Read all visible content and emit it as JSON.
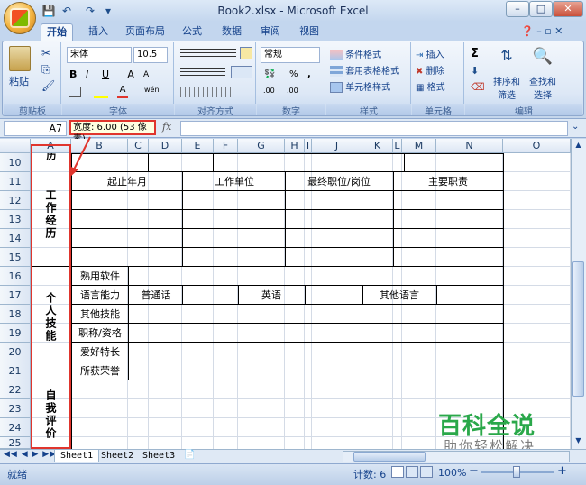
{
  "window": {
    "title": "Book2.xlsx - Microsoft Excel",
    "min": "–",
    "max": "□",
    "close": "✕"
  },
  "qat": {
    "save": "💾",
    "undo": "↶",
    "redo": "↷",
    "more": "▾"
  },
  "tabs": [
    "开始",
    "插入",
    "页面布局",
    "公式",
    "数据",
    "审阅",
    "视图"
  ],
  "ribbon": {
    "paste": "粘贴",
    "font_name": "宋体",
    "font_size": "10.5",
    "bold": "B",
    "italic": "I",
    "underline": "U",
    "grow": "A",
    "shrink": "A",
    "wen": "wén",
    "number_format": "常规",
    "percent": "%",
    "comma": ",",
    "inc_dec": ".00",
    "dec_dec": ".00",
    "cond_format": "条件格式",
    "table_format": "套用表格格式",
    "cell_style": "单元格样式",
    "insert": "插入",
    "delete": "删除",
    "format": "格式",
    "sigma": "Σ",
    "sort_filter_1": "排序和",
    "sort_filter_2": "筛选",
    "find_select_1": "查找和",
    "find_select_2": "选择",
    "groups": {
      "clipboard": "剪贴板",
      "font": "字体",
      "align": "对齐方式",
      "number": "数字",
      "styles": "样式",
      "cells": "单元格",
      "edit": "编辑"
    }
  },
  "formula_bar": {
    "namebox": "A7",
    "tooltip": "宽度: 6.00 (53 像素)",
    "fx": "fx"
  },
  "columns": [
    "A",
    "B",
    "C",
    "D",
    "E",
    "F",
    "G",
    "H",
    "I",
    "J",
    "K",
    "L",
    "M",
    "N",
    "O"
  ],
  "rows": [
    "10",
    "11",
    "12",
    "13",
    "14",
    "15",
    "16",
    "17",
    "18",
    "19",
    "20",
    "21",
    "22",
    "23",
    "24",
    "25"
  ],
  "cells": {
    "r10_a": "历",
    "r11_period": "起止年月",
    "r11_employer": "工作单位",
    "r11_position": "最终职位/岗位",
    "r11_duty": "主要职责",
    "work_label": "工作经历",
    "skills_label": "个人技能",
    "self_label": "自我评价",
    "r16": "熟用软件",
    "r17": "语言能力",
    "r17_c": "普通话",
    "r17_g": "英语",
    "r17_k": "其他语言",
    "r18": "其他技能",
    "r19": "职称/资格",
    "r20": "爱好特长",
    "r21": "所获荣誉"
  },
  "sheets": [
    "Sheet1",
    "Sheet2",
    "Sheet3"
  ],
  "status": {
    "ready": "就绪",
    "count": "计数: 6",
    "zoom": "100%",
    "minus": "−",
    "plus": "+"
  },
  "watermark": {
    "title": "百科全说",
    "subtitle": "助你轻松解决"
  },
  "colors": {
    "accent": "#15428b",
    "highlight": "#e0352d",
    "watermark": "#2aa84a"
  }
}
